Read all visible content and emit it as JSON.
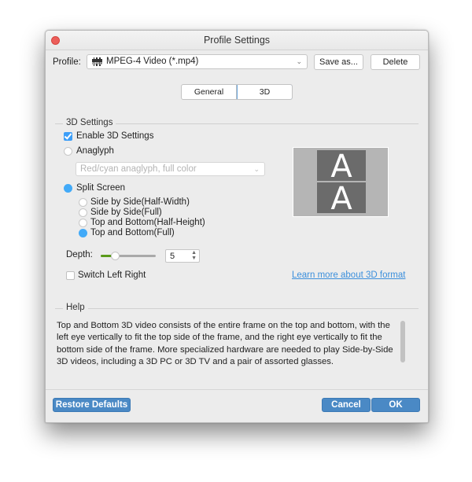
{
  "window": {
    "title": "Profile Settings"
  },
  "profile": {
    "label": "Profile:",
    "icon": "mpeg-film-icon",
    "icon_text": "MPEG",
    "value": "MPEG-4 Video (*.mp4)",
    "save_as_label": "Save as...",
    "delete_label": "Delete"
  },
  "tabs": [
    {
      "label": "General",
      "active": false
    },
    {
      "label": "3D",
      "active": true
    }
  ],
  "settings_3d": {
    "group_title": "3D Settings",
    "enable_label": "Enable 3D Settings",
    "enable_checked": true,
    "anaglyph_label": "Anaglyph",
    "anaglyph_selected": false,
    "anaglyph_option": "Red/cyan anaglyph, full color",
    "split_label": "Split Screen",
    "split_selected": true,
    "split_options": [
      {
        "label": "Side by Side(Half-Width)",
        "selected": false
      },
      {
        "label": "Side by Side(Full)",
        "selected": false
      },
      {
        "label": "Top and Bottom(Half-Height)",
        "selected": false
      },
      {
        "label": "Top and Bottom(Full)",
        "selected": true
      }
    ],
    "preview_letter": "A",
    "depth_label": "Depth:",
    "depth_value": "5",
    "depth_slider_fraction": 0.25,
    "switch_label": "Switch Left Right",
    "switch_checked": false,
    "learn_more_link": "Learn more about 3D format"
  },
  "help": {
    "group_title": "Help",
    "text": "Top and Bottom 3D video consists of the entire frame on the top and bottom, with the left eye vertically to fit the top side of the frame, and the right eye vertically to fit the bottom side of the frame. More specialized hardware are needed to play Side-by-Side 3D videos, including a 3D PC or 3D TV and a pair of assorted glasses."
  },
  "footer": {
    "restore_label": "Restore Defaults",
    "cancel_label": "Cancel",
    "ok_label": "OK"
  },
  "colors": {
    "accent": "#42aaf8",
    "primary_button": "#4a89c5",
    "link": "#3b8fdc",
    "slider_fill": "#5a9a1a",
    "close_button": "#ec5e5a"
  }
}
